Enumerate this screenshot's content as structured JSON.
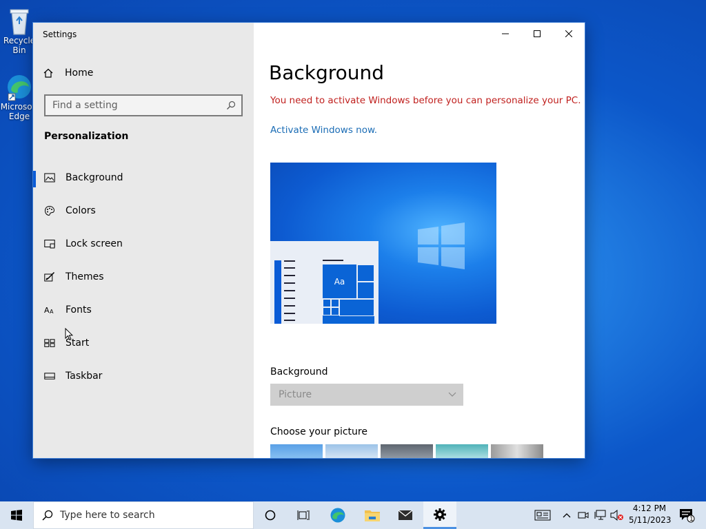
{
  "desktop": {
    "icons": [
      {
        "label": "Recycle Bin",
        "icon": "recycle-bin-icon"
      },
      {
        "label": "Microsoft\nEdge",
        "icon": "edge-icon"
      }
    ]
  },
  "window": {
    "title": "Settings",
    "controls": {
      "minimize": "minimize-icon",
      "maximize": "maximize-icon",
      "close": "close-icon"
    }
  },
  "sidebar": {
    "home_label": "Home",
    "search_placeholder": "Find a setting",
    "section_title": "Personalization",
    "items": [
      {
        "label": "Background",
        "icon": "picture-icon",
        "active": true
      },
      {
        "label": "Colors",
        "icon": "palette-icon"
      },
      {
        "label": "Lock screen",
        "icon": "lock-screen-icon"
      },
      {
        "label": "Themes",
        "icon": "themes-icon"
      },
      {
        "label": "Fonts",
        "icon": "fonts-icon"
      },
      {
        "label": "Start",
        "icon": "start-icon"
      },
      {
        "label": "Taskbar",
        "icon": "taskbar-icon"
      }
    ]
  },
  "content": {
    "title": "Background",
    "warning": "You need to activate Windows before you can personalize your PC.",
    "activate_link": "Activate Windows now.",
    "preview_tile_label": "Aa",
    "background_label": "Background",
    "background_value": "Picture",
    "choose_picture_label": "Choose your picture"
  },
  "taskbar": {
    "search_placeholder": "Type here to search",
    "time": "4:12 PM",
    "date": "5/11/2023",
    "notification_count": "1"
  },
  "colors": {
    "accent": "#0a5bd6",
    "warning": "#c0201e",
    "link": "#1a6cb5"
  }
}
